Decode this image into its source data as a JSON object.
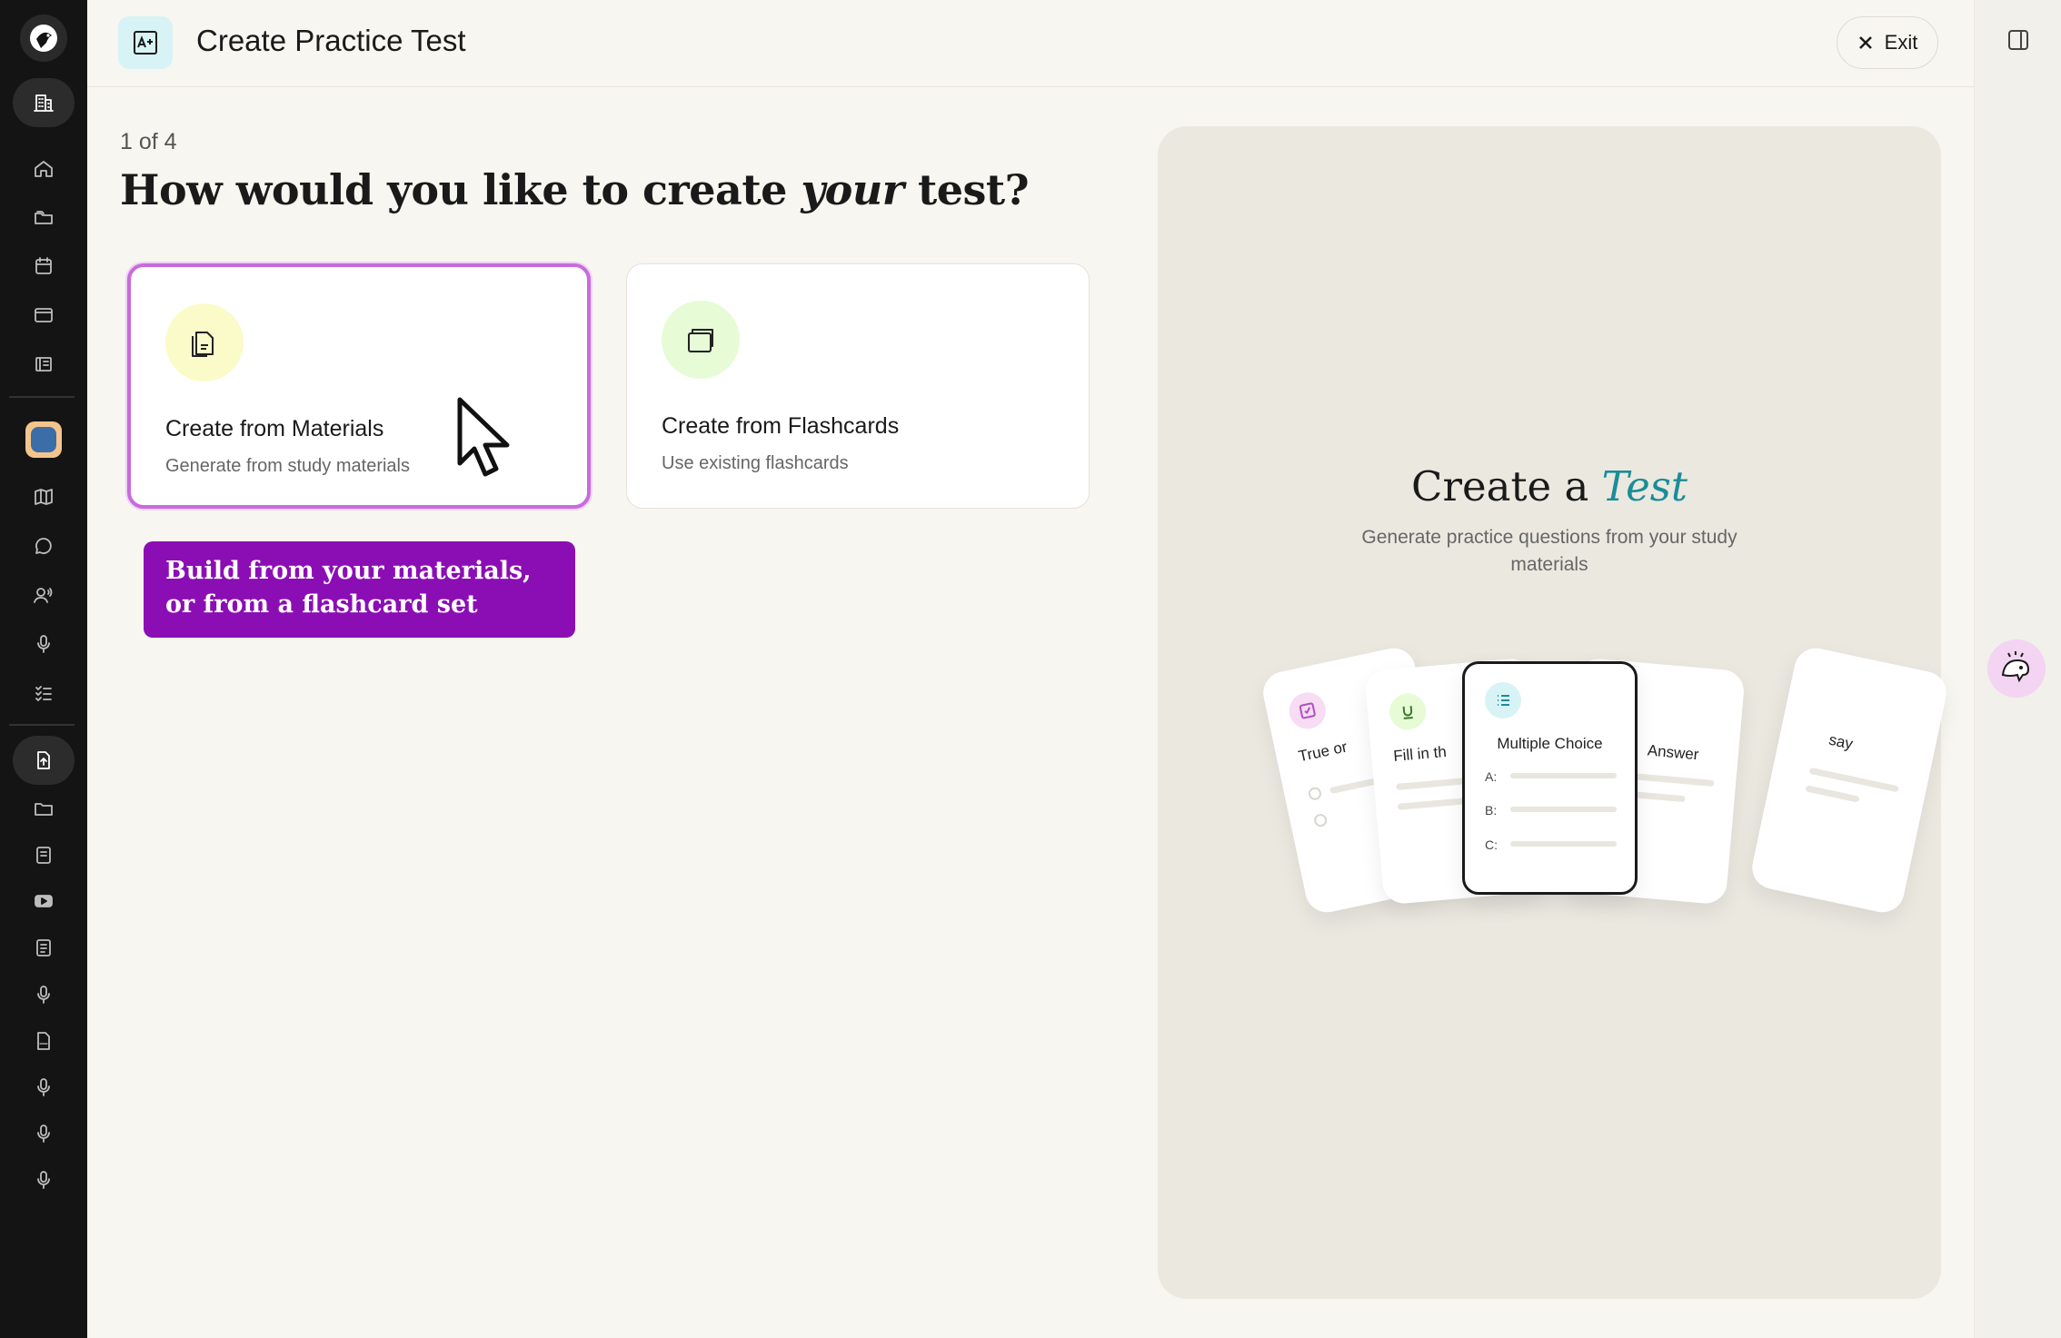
{
  "header": {
    "title": "Create Practice Test",
    "exit_label": "Exit"
  },
  "step": "1 of 4",
  "question": {
    "before": "How would you like to create ",
    "emphasis": "your",
    "after": " test?"
  },
  "options": [
    {
      "title": "Create from Materials",
      "subtitle": "Generate from study materials",
      "icon": "document-icon",
      "icon_bg": "#fbfbc9",
      "selected": true
    },
    {
      "title": "Create from Flashcards",
      "subtitle": "Use existing flashcards",
      "icon": "flashcards-icon",
      "icon_bg": "#e6fbd6",
      "selected": false
    }
  ],
  "tooltip": "Build from your materials, or from a flashcard set",
  "preview": {
    "title_before": "Create a ",
    "title_emphasis": "Test",
    "subtitle": "Generate practice questions from your study materials",
    "cards": [
      {
        "label": "True or",
        "icon": "checkbox-icon"
      },
      {
        "label": "Fill in th",
        "icon": "underline-icon"
      },
      {
        "label": "Multiple Choice",
        "icon": "list-icon",
        "options": [
          "A:",
          "B:",
          "C:"
        ]
      },
      {
        "label": "Answer"
      },
      {
        "label": "say"
      }
    ]
  },
  "colors": {
    "accent_selected": "#c86bdc",
    "tooltip_bg": "#8b0eb5",
    "test_teal": "#1a8d98"
  }
}
